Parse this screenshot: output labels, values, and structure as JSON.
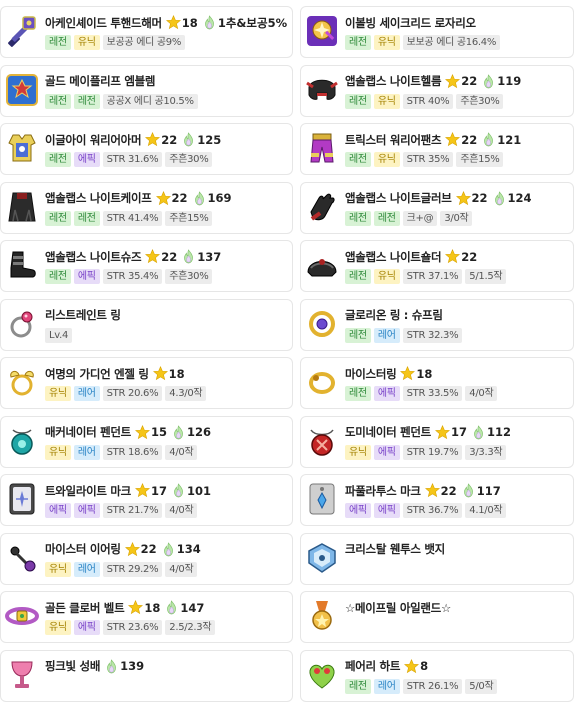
{
  "items": [
    {
      "name": "아케인셰이드 투핸드해머",
      "icon": "two-handed-hammer-icon",
      "star": "18",
      "flame": "",
      "extra": "1추&보공5%",
      "tags": [
        {
          "t": "레전",
          "c": "legend"
        },
        {
          "t": "유닉",
          "c": "unique"
        },
        {
          "t": "보공공 에디 공9%",
          "c": "plain"
        }
      ]
    },
    {
      "name": "이볼빙 세이크리드 로자리오",
      "icon": "rosario-icon",
      "star": "",
      "flame": "",
      "extra": "",
      "tags": [
        {
          "t": "레전",
          "c": "legend"
        },
        {
          "t": "유닉",
          "c": "unique"
        },
        {
          "t": "보보공 에디 공16.4%",
          "c": "plain"
        }
      ]
    },
    {
      "name": "골드 메이플리프 엠블렘",
      "icon": "emblem-icon",
      "star": "",
      "flame": "",
      "extra": "",
      "tags": [
        {
          "t": "레전",
          "c": "legend"
        },
        {
          "t": "레전",
          "c": "legend"
        },
        {
          "t": "공공X 에디 공10.5%",
          "c": "plain"
        }
      ]
    },
    {
      "name": "앱솔랩스 나이트헬름",
      "icon": "helmet-icon",
      "star": "22",
      "flame": "119",
      "extra": "",
      "tags": [
        {
          "t": "레전",
          "c": "legend"
        },
        {
          "t": "유닉",
          "c": "unique"
        },
        {
          "t": "STR 40%",
          "c": "plain"
        },
        {
          "t": "주흔30%",
          "c": "plain"
        }
      ]
    },
    {
      "name": "이글아이 워리어아머",
      "icon": "armor-icon",
      "star": "22",
      "flame": "125",
      "extra": "",
      "tags": [
        {
          "t": "레전",
          "c": "legend"
        },
        {
          "t": "에픽",
          "c": "epic"
        },
        {
          "t": "STR 31.6%",
          "c": "plain"
        },
        {
          "t": "주흔30%",
          "c": "plain"
        }
      ]
    },
    {
      "name": "트릭스터 워리어팬츠",
      "icon": "pants-icon",
      "star": "22",
      "flame": "121",
      "extra": "",
      "tags": [
        {
          "t": "레전",
          "c": "legend"
        },
        {
          "t": "유닉",
          "c": "unique"
        },
        {
          "t": "STR 35%",
          "c": "plain"
        },
        {
          "t": "주흔15%",
          "c": "plain"
        }
      ]
    },
    {
      "name": "앱솔랩스 나이트케이프",
      "icon": "cape-icon",
      "star": "22",
      "flame": "169",
      "extra": "",
      "tags": [
        {
          "t": "레전",
          "c": "legend"
        },
        {
          "t": "레전",
          "c": "legend"
        },
        {
          "t": "STR 41.4%",
          "c": "plain"
        },
        {
          "t": "주흔15%",
          "c": "plain"
        }
      ]
    },
    {
      "name": "앱솔랩스 나이트글러브",
      "icon": "glove-icon",
      "star": "22",
      "flame": "124",
      "extra": "",
      "tags": [
        {
          "t": "레전",
          "c": "legend"
        },
        {
          "t": "레전",
          "c": "legend"
        },
        {
          "t": "크+@",
          "c": "plain"
        },
        {
          "t": "3/0작",
          "c": "plain"
        }
      ]
    },
    {
      "name": "앱솔랩스 나이트슈즈",
      "icon": "shoes-icon",
      "star": "22",
      "flame": "137",
      "extra": "",
      "tags": [
        {
          "t": "레전",
          "c": "legend"
        },
        {
          "t": "에픽",
          "c": "epic"
        },
        {
          "t": "STR 35.4%",
          "c": "plain"
        },
        {
          "t": "주흔30%",
          "c": "plain"
        }
      ]
    },
    {
      "name": "앱솔랩스 나이트숄더",
      "icon": "shoulder-icon",
      "star": "22",
      "flame": "",
      "extra": "",
      "tags": [
        {
          "t": "레전",
          "c": "legend"
        },
        {
          "t": "유닉",
          "c": "unique"
        },
        {
          "t": "STR 37.1%",
          "c": "plain"
        },
        {
          "t": "5/1.5작",
          "c": "plain"
        }
      ]
    },
    {
      "name": "리스트레인트 링",
      "icon": "ring-pink-icon",
      "star": "",
      "flame": "",
      "extra": "",
      "tags": [
        {
          "t": "Lv.4",
          "c": "plain"
        }
      ]
    },
    {
      "name": "글로리온 링 : 슈프림",
      "icon": "ring-gold-icon",
      "star": "",
      "flame": "",
      "extra": "",
      "tags": [
        {
          "t": "레전",
          "c": "legend"
        },
        {
          "t": "레어",
          "c": "rare"
        },
        {
          "t": "STR 32.3%",
          "c": "plain"
        }
      ]
    },
    {
      "name": "여명의 가디언 엔젤 링",
      "icon": "ring-angel-icon",
      "star": "18",
      "flame": "",
      "extra": "",
      "tags": [
        {
          "t": "유닉",
          "c": "unique"
        },
        {
          "t": "레어",
          "c": "rare"
        },
        {
          "t": "STR 20.6%",
          "c": "plain"
        },
        {
          "t": "4.3/0작",
          "c": "plain"
        }
      ]
    },
    {
      "name": "마이스터링",
      "icon": "ring-meister-icon",
      "star": "18",
      "flame": "",
      "extra": "",
      "tags": [
        {
          "t": "레전",
          "c": "legend"
        },
        {
          "t": "에픽",
          "c": "epic"
        },
        {
          "t": "STR 33.5%",
          "c": "plain"
        },
        {
          "t": "4/0작",
          "c": "plain"
        }
      ]
    },
    {
      "name": "매커네이터 펜던트",
      "icon": "pendant-mech-icon",
      "star": "15",
      "flame": "126",
      "extra": "",
      "tags": [
        {
          "t": "유닉",
          "c": "unique"
        },
        {
          "t": "레어",
          "c": "rare"
        },
        {
          "t": "STR 18.6%",
          "c": "plain"
        },
        {
          "t": "4/0작",
          "c": "plain"
        }
      ]
    },
    {
      "name": "도미네이터 펜던트",
      "icon": "pendant-dom-icon",
      "star": "17",
      "flame": "112",
      "extra": "",
      "tags": [
        {
          "t": "유닉",
          "c": "unique"
        },
        {
          "t": "에픽",
          "c": "epic"
        },
        {
          "t": "STR 19.7%",
          "c": "plain"
        },
        {
          "t": "3/3.3작",
          "c": "plain"
        }
      ]
    },
    {
      "name": "트와일라이트 마크",
      "icon": "twilight-mark-icon",
      "star": "17",
      "flame": "101",
      "extra": "",
      "tags": [
        {
          "t": "에픽",
          "c": "epic"
        },
        {
          "t": "에픽",
          "c": "epic"
        },
        {
          "t": "STR 21.7%",
          "c": "plain"
        },
        {
          "t": "4/0작",
          "c": "plain"
        }
      ]
    },
    {
      "name": "파풀라투스 마크",
      "icon": "papulatus-mark-icon",
      "star": "22",
      "flame": "117",
      "extra": "",
      "tags": [
        {
          "t": "에픽",
          "c": "epic"
        },
        {
          "t": "에픽",
          "c": "epic"
        },
        {
          "t": "STR 36.7%",
          "c": "plain"
        },
        {
          "t": "4.1/0작",
          "c": "plain"
        }
      ]
    },
    {
      "name": "마이스터 이어링",
      "icon": "earring-icon",
      "star": "22",
      "flame": "134",
      "extra": "",
      "tags": [
        {
          "t": "유닉",
          "c": "unique"
        },
        {
          "t": "레어",
          "c": "rare"
        },
        {
          "t": "STR 29.2%",
          "c": "plain"
        },
        {
          "t": "4/0작",
          "c": "plain"
        }
      ]
    },
    {
      "name": "크리스탈 웬투스 뱃지",
      "icon": "badge-icon",
      "star": "",
      "flame": "",
      "extra": "",
      "tags": []
    },
    {
      "name": "골든 클로버 벨트",
      "icon": "belt-icon",
      "star": "18",
      "flame": "147",
      "extra": "",
      "tags": [
        {
          "t": "유닉",
          "c": "unique"
        },
        {
          "t": "에픽",
          "c": "epic"
        },
        {
          "t": "STR 23.6%",
          "c": "plain"
        },
        {
          "t": "2.5/2.3작",
          "c": "plain"
        }
      ]
    },
    {
      "name": "☆메이프릴 아일랜드☆",
      "icon": "medal-icon",
      "star": "",
      "flame": "",
      "extra": "",
      "tags": []
    },
    {
      "name": "핑크빛 성배",
      "icon": "chalice-icon",
      "star": "",
      "flame": "139",
      "extra": "",
      "tags": []
    },
    {
      "name": "페어리 하트",
      "icon": "fairy-heart-icon",
      "star": "8",
      "flame": "",
      "extra": "",
      "tags": [
        {
          "t": "레전",
          "c": "legend"
        },
        {
          "t": "레어",
          "c": "rare"
        },
        {
          "t": "STR 26.1%",
          "c": "plain"
        },
        {
          "t": "5/0작",
          "c": "plain"
        }
      ]
    }
  ]
}
